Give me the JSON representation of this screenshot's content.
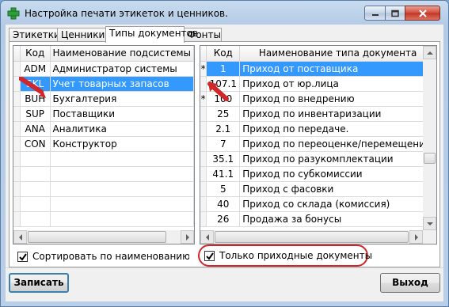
{
  "window": {
    "title": "Настройка печати этикеток и ценников.",
    "app_icon": "green-plus-icon"
  },
  "tabs": [
    {
      "label": "Этикетки",
      "active": false
    },
    {
      "label": "Ценники",
      "active": false
    },
    {
      "label": "Типы документов",
      "active": true
    },
    {
      "label": "Фонты",
      "active": false
    }
  ],
  "left_grid": {
    "columns": [
      "Код",
      "Наименование подсистемы"
    ],
    "rows": [
      {
        "code": "ADM",
        "name": "Администратор системы",
        "selected": false
      },
      {
        "code": "SKL",
        "name": "Учет товарных запасов",
        "selected": true
      },
      {
        "code": "BUH",
        "name": "Бухгалтерия",
        "selected": false
      },
      {
        "code": "SUP",
        "name": "Поставщики",
        "selected": false
      },
      {
        "code": "ANA",
        "name": "Аналитика",
        "selected": false
      },
      {
        "code": "CON",
        "name": "Конструктор",
        "selected": false
      }
    ],
    "checkbox_label": "Сортировать по наименованию товаров",
    "checkbox_checked": true
  },
  "right_grid": {
    "columns": [
      "Код",
      "Наименование типа документа"
    ],
    "rows": [
      {
        "marker": "*",
        "code": "1",
        "name": "Приход от поставщика",
        "selected": true
      },
      {
        "marker": "",
        "code": "107.1",
        "name": "Приход от юр.лица",
        "selected": false
      },
      {
        "marker": "*",
        "code": "100",
        "name": "Приход по внедрению",
        "selected": false
      },
      {
        "marker": "",
        "code": "25",
        "name": "Приход по инвентаризации",
        "selected": false
      },
      {
        "marker": "",
        "code": "2.1",
        "name": "Приход по передаче.",
        "selected": false
      },
      {
        "marker": "",
        "code": "7",
        "name": "Приход по переоценке/перемещению",
        "selected": false
      },
      {
        "marker": "",
        "code": "35.1",
        "name": "Приход по разукомплектации",
        "selected": false
      },
      {
        "marker": "",
        "code": "41.1",
        "name": "Приход по субкомиссии",
        "selected": false
      },
      {
        "marker": "",
        "code": "5",
        "name": "Приход с фасовки",
        "selected": false
      },
      {
        "marker": "",
        "code": "40",
        "name": "Приход со склада (комиссия)",
        "selected": false
      },
      {
        "marker": "",
        "code": "26",
        "name": "Продажа за бонусы",
        "selected": false
      }
    ],
    "checkbox_label": "Только приходные документы",
    "checkbox_checked": true
  },
  "buttons": {
    "save": "Записать",
    "exit": "Выход"
  },
  "colors": {
    "selection": "#3399ff",
    "annotation_red": "#d0282a"
  }
}
